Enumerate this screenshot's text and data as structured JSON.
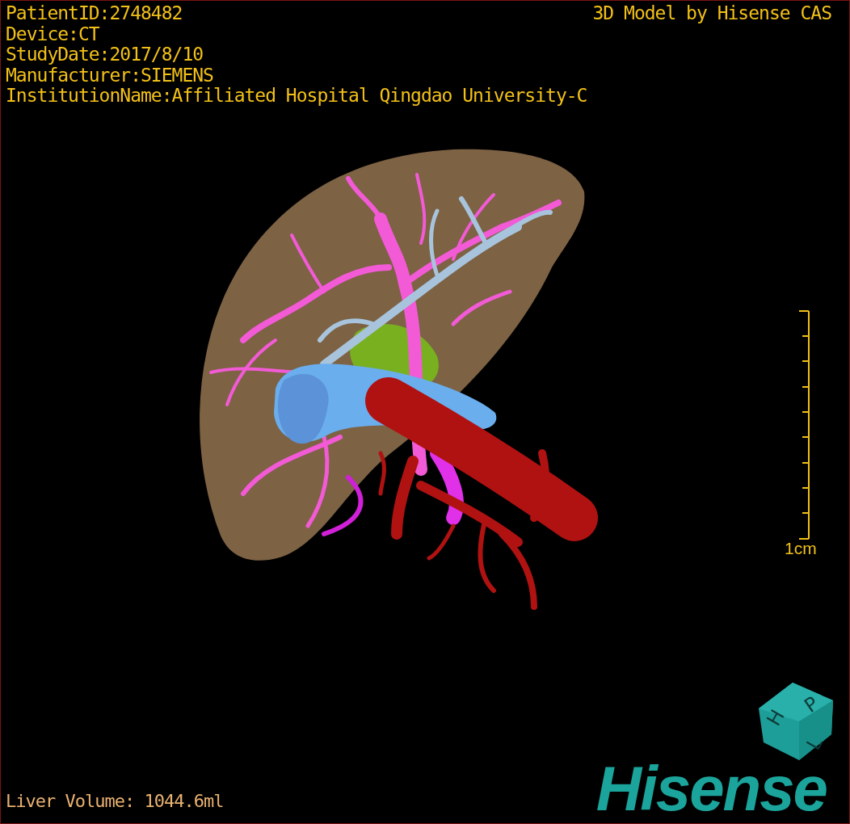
{
  "patient_info": [
    "PatientID:2748482",
    "Device:CT",
    "StudyDate:2017/8/10",
    "Manufacturer:SIEMENS",
    "InstitutionName:Affiliated Hospital Qingdao University-C"
  ],
  "header_right": "3D Model by Hisense CAS",
  "scale_bar": {
    "label": "1cm"
  },
  "measurement": "Liver Volume: 1044.6ml",
  "logo": {
    "text": "Hisense",
    "cube_letters": [
      "H",
      "P",
      "L"
    ]
  }
}
